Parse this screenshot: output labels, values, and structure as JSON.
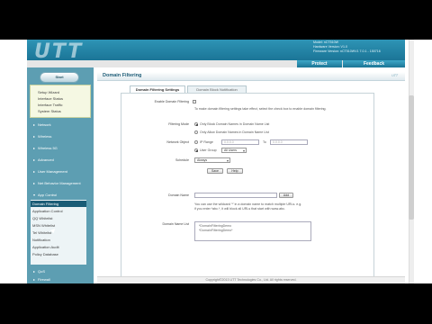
{
  "header": {
    "logo": "UTT",
    "model_line": "Model: nCT510W",
    "hardware_line": "Hardware Version: V1.0",
    "firmware_line": "Firmware Version: nCT510WV1 7.0.1 - 150716"
  },
  "topnav": {
    "protect": "Protect",
    "feedback": "Feedback"
  },
  "sidebar": {
    "start_button": "Start",
    "status_items": [
      "Setup Wizard",
      "Interface Status",
      "Interface Traffic",
      "System Status"
    ],
    "menu": [
      {
        "label": "Network"
      },
      {
        "label": "Wireless"
      },
      {
        "label": "Wireless 5G"
      },
      {
        "label": "Advanced"
      },
      {
        "label": "User Management"
      },
      {
        "label": "Net Behavior Management"
      },
      {
        "label": "App Control"
      }
    ],
    "submenu": [
      {
        "label": "Domain Filtering",
        "selected": true
      },
      {
        "label": "Application Control",
        "selected": false
      },
      {
        "label": "QQ Whitelist",
        "selected": false
      },
      {
        "label": "MSN Whitelist",
        "selected": false
      },
      {
        "label": "Tel Whitelist",
        "selected": false
      },
      {
        "label": "Notification",
        "selected": false
      },
      {
        "label": "Application Audit",
        "selected": false
      },
      {
        "label": "Policy Database",
        "selected": false
      }
    ],
    "bottom_menu": [
      {
        "label": "QoS"
      },
      {
        "label": "Firewall"
      }
    ]
  },
  "content": {
    "title": "Domain Filtering",
    "brand": "UTT",
    "tabs": [
      "Domain Filtering Settings",
      "Domain Block Notification"
    ],
    "enable_label": "Enable Domain Filtering",
    "enable_desc": "To make domain filtering settings take effect, select the check box to enable domain filtering.",
    "filtering_mode_label": "Filtering Mode",
    "mode_block": "Only Block Domain Names in Domain Name List",
    "mode_allow": "Only Allow Domain Names in Domain Name List",
    "network_object_label": "Network Object",
    "ip_range_label": "IP Range",
    "ip_from": "0.0.0.0",
    "ip_to_label": "To",
    "ip_to": "0.0.0.0",
    "user_group_label": "User Group",
    "user_group_value": "All Users",
    "schedule_label": "Schedule",
    "schedule_value": "Always",
    "save_button": "Save",
    "help_button": "Help",
    "domain_name_label": "Domain Name",
    "add_button": "Add",
    "domain_desc_1": "You can use the wildcard '*' in a domain name to match multiple URLs. e.g.",
    "domain_desc_2": "if you enter *abc.*, it will block all URLs that start with www.abc.",
    "domain_list_label": "Domain Name List",
    "domain_list": [
      "*DomainFilteringDemo",
      "*DomainFilteringDemo*"
    ]
  },
  "footer": {
    "text": "Copyright©2013 UTT Technologies Co., Ltd. All rights reserved."
  }
}
